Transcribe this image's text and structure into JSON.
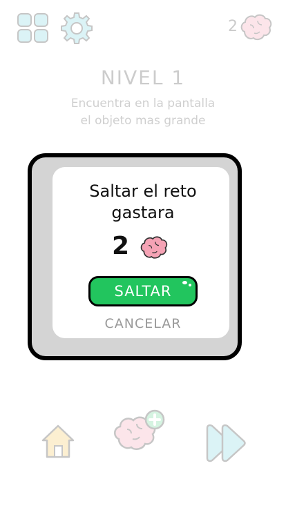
{
  "header": {
    "menu_icon": "grid-icon",
    "settings_icon": "gear-icon",
    "brain_count": "2",
    "brain_icon": "brain-icon"
  },
  "level": {
    "title": "NIVEL 1",
    "description": "Encuentra en la pantalla\nel objeto mas grande"
  },
  "modal": {
    "title": "Saltar el reto\ngastara",
    "cost": "2",
    "cost_icon": "brain-icon",
    "skip_label": "SALTAR",
    "cancel_label": "CANCELAR"
  },
  "bottom": {
    "home_icon": "home-icon",
    "hint_icon": "brain-plus-icon",
    "next_icon": "skip-forward-icon"
  },
  "colors": {
    "accent_green": "#22c55e",
    "brain_pink": "#f5a3b5",
    "icon_cyan": "#7fd3dd",
    "home_yellow": "#f4c45a"
  }
}
